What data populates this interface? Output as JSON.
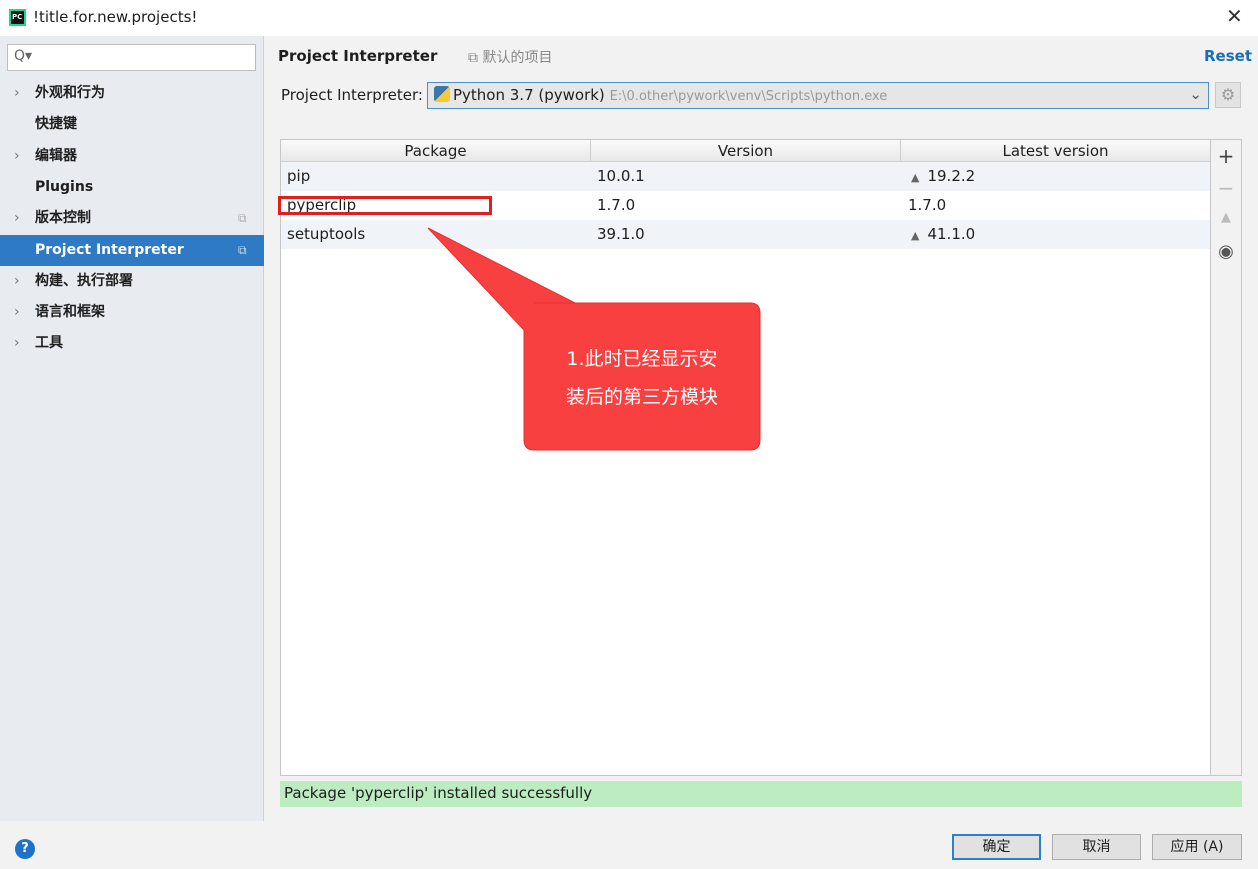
{
  "window": {
    "title": "!title.for.new.projects!",
    "close": "✕"
  },
  "sidebar": {
    "search_icon": "Q▾",
    "items": [
      {
        "label": "外观和行为",
        "chevron": true,
        "copy": false
      },
      {
        "label": "快捷键",
        "chevron": false,
        "copy": false
      },
      {
        "label": "编辑器",
        "chevron": true,
        "copy": false
      },
      {
        "label": "Plugins",
        "chevron": false,
        "copy": false
      },
      {
        "label": "版本控制",
        "chevron": true,
        "copy": true
      },
      {
        "label": "Project Interpreter",
        "chevron": false,
        "copy": true,
        "selected": true
      },
      {
        "label": "构建、执行部署",
        "chevron": true,
        "copy": false
      },
      {
        "label": "语言和框架",
        "chevron": true,
        "copy": false
      },
      {
        "label": "工具",
        "chevron": true,
        "copy": false
      }
    ]
  },
  "header": {
    "title": "Project Interpreter",
    "scope": "默认的项目",
    "reset": "Reset"
  },
  "interpreter": {
    "label": "Project Interpreter:",
    "name": "Python 3.7 (pywork)",
    "path": "E:\\0.other\\pywork\\venv\\Scripts\\python.exe"
  },
  "table": {
    "columns": [
      "Package",
      "Version",
      "Latest version"
    ],
    "rows": [
      {
        "package": "pip",
        "version": "10.0.1",
        "latest": "19.2.2",
        "upgrade": true
      },
      {
        "package": "pyperclip",
        "version": "1.7.0",
        "latest": "1.7.0",
        "upgrade": false
      },
      {
        "package": "setuptools",
        "version": "39.1.0",
        "latest": "41.1.0",
        "upgrade": true
      }
    ]
  },
  "status": "Package 'pyperclip' installed successfully",
  "buttons": {
    "ok": "确定",
    "cancel": "取消",
    "apply": "应用 (A)"
  },
  "annotation": {
    "line1": "1.此时已经显示安",
    "line2": "装后的第三方模块",
    "color": "#f84040"
  },
  "colors": {
    "selection": "#2e7ac4",
    "status_bg": "#bcecc0",
    "link": "#1a6fb3"
  }
}
